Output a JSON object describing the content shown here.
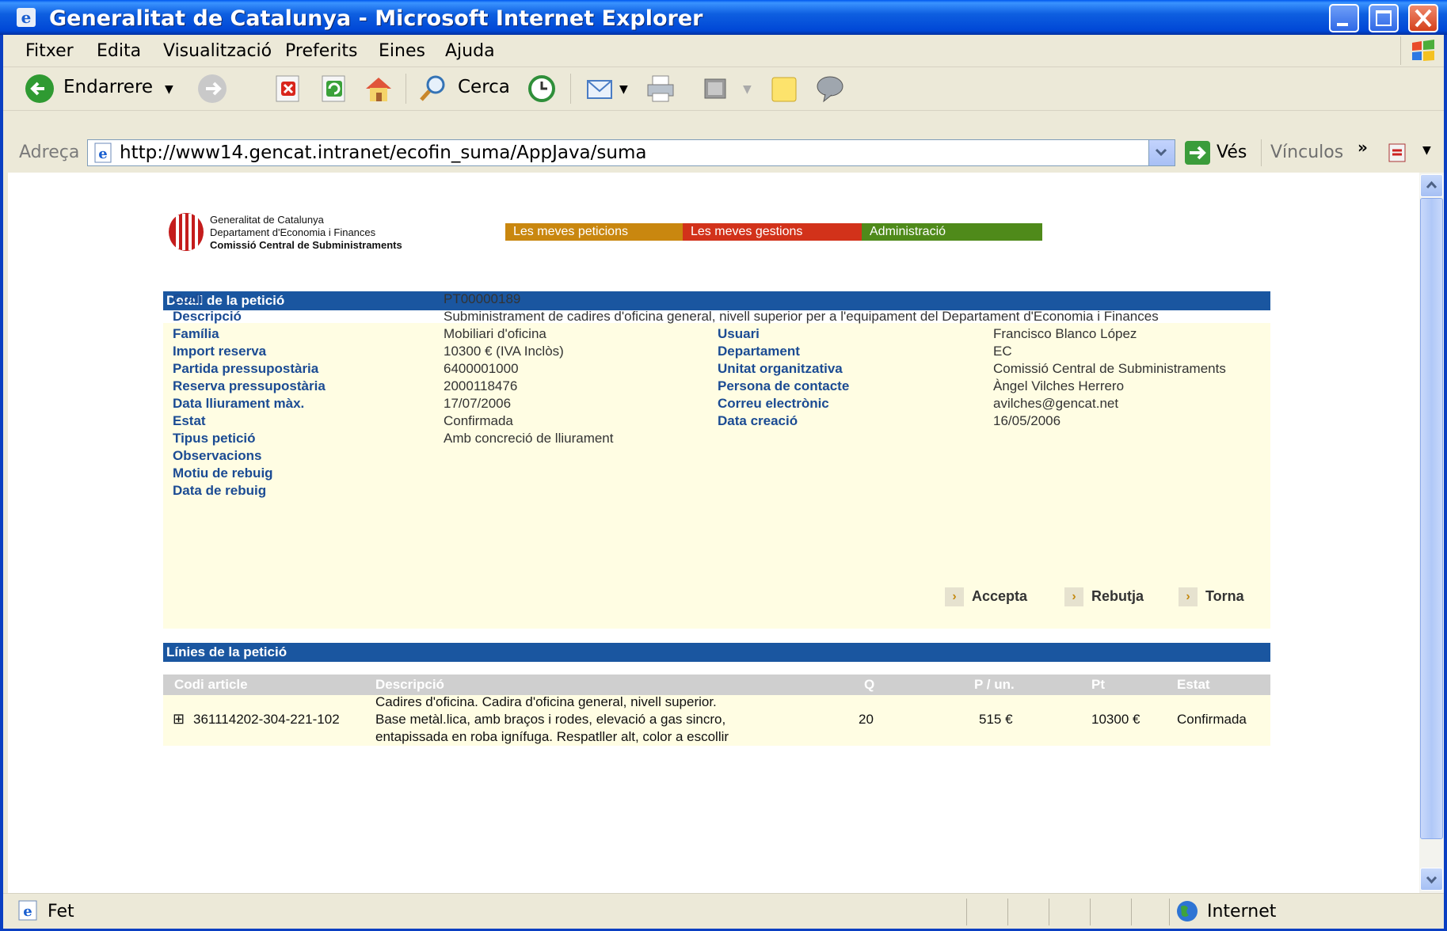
{
  "window": {
    "title": "Generalitat de Catalunya - Microsoft Internet Explorer"
  },
  "menu": [
    "Fitxer",
    "Edita",
    "Visualització",
    "Preferits",
    "Eines",
    "Ajuda"
  ],
  "toolbar": {
    "back_label": "Endarrere",
    "search_label": "Cerca"
  },
  "address": {
    "label": "Adreça",
    "url": "http://www14.gencat.intranet/ecofin_suma/AppJava/suma",
    "go_label": "Vés",
    "links_label": "Vínculos"
  },
  "status": {
    "text": "Fet",
    "zone": "Internet"
  },
  "page": {
    "logo": {
      "line1": "Generalitat de Catalunya",
      "line2": "Departament d'Economia i Finances",
      "line3": "Comissió Central de Subministraments"
    },
    "nav": [
      {
        "label": "Les meves peticions",
        "color": "#c9870f"
      },
      {
        "label": "Les meves gestions",
        "color": "#d2321a"
      },
      {
        "label": "Administració",
        "color": "#4f8a1a"
      }
    ],
    "detail_title": "Detall de la petició",
    "detail_left": [
      {
        "label": "Codi",
        "value": "PT00000189"
      },
      {
        "label": "Descripció",
        "value": "Subministrament de cadires d'oficina general, nivell superior per a l'equipament del Departament d'Economia i Finances"
      },
      {
        "label": "Família",
        "value": "Mobiliari d'oficina"
      },
      {
        "label": "Import reserva",
        "value": "10300 € (IVA Inclòs)"
      },
      {
        "label": "Partida pressupostària",
        "value": "6400001000"
      },
      {
        "label": "Reserva pressupostària",
        "value": "2000118476"
      },
      {
        "label": "Data lliurament màx.",
        "value": "17/07/2006"
      },
      {
        "label": "Estat",
        "value": "Confirmada"
      },
      {
        "label": "Tipus petició",
        "value": "Amb concreció de lliurament"
      },
      {
        "label": "Observacions",
        "value": ""
      },
      {
        "label": "Motiu de rebuig",
        "value": ""
      },
      {
        "label": "Data de rebuig",
        "value": ""
      }
    ],
    "detail_right": [
      {
        "label": "Usuari",
        "value": "Francisco Blanco López"
      },
      {
        "label": "Departament",
        "value": "EC"
      },
      {
        "label": "Unitat organitzativa",
        "value": "Comissió Central de Subministraments"
      },
      {
        "label": "Persona de contacte",
        "value": "Àngel Vilches Herrero"
      },
      {
        "label": "Correu electrònic",
        "value": "avilches@gencat.net"
      },
      {
        "label": "Data creació",
        "value": "16/05/2006"
      }
    ],
    "actions": [
      "Accepta",
      "Rebutja",
      "Torna"
    ],
    "lines_title": "Línies de la petició",
    "lines_columns": [
      "Codi article",
      "Descripció",
      "Q",
      "P / un.",
      "Pt",
      "Estat"
    ],
    "lines": [
      {
        "expander": "⊞",
        "code": "361114202-304-221-102",
        "desc1": "Cadires d'oficina. Cadira d'oficina general, nivell superior.",
        "desc2": "Base metàl.lica, amb braços i rodes, elevació a gas sincro,",
        "desc3": "entapissada en roba ignífuga. Respatller alt, color a escollir",
        "q": "20",
        "unit_price": "515 €",
        "total": "10300 €",
        "status": "Confirmada"
      }
    ]
  }
}
